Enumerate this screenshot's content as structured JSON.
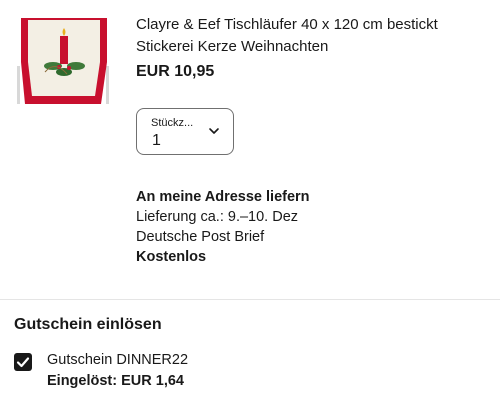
{
  "product": {
    "image_icon": "table-runner-product-image",
    "title": "Clayre & Eef Tischläufer 40 x 120 cm bestickt Stickerei Kerze Weihnachten",
    "price": "EUR 10,95"
  },
  "quantity": {
    "label": "Stückz...",
    "value": "1"
  },
  "delivery": {
    "heading": "An meine Adresse liefern",
    "estimate": "Lieferung ca.: 9.–10. Dez",
    "carrier": "Deutsche Post Brief",
    "cost": "Kostenlos"
  },
  "coupon": {
    "title": "Gutschein einlösen",
    "name": "Gutschein DINNER22",
    "applied": "Eingelöst: EUR 1,64",
    "checked": true
  },
  "colors": {
    "text": "#191919",
    "runner_red": "#c8102e",
    "divider": "#e5e5e5"
  }
}
